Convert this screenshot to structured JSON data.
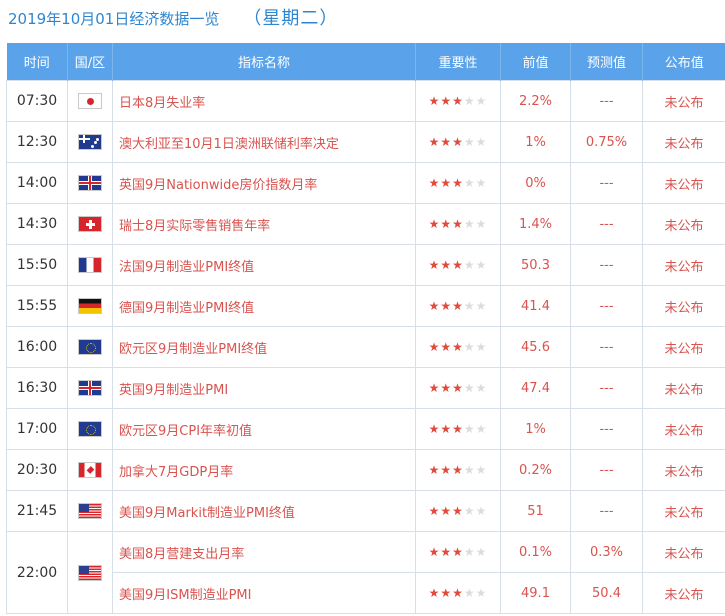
{
  "title": {
    "date_text": "2019年10月01日经济数据一览",
    "weekday": "（星期二）"
  },
  "headers": [
    "时间",
    "国/区",
    "指标名称",
    "重要性",
    "前值",
    "预测值",
    "公布值"
  ],
  "colors": {
    "accent": "#2f86d0",
    "header_bg": "#5aa3ea",
    "value_red": "#d9534f",
    "star_on": "#e14b3b",
    "star_off": "#dcdcdc"
  },
  "groups": [
    {
      "time": "07:30",
      "flag": "japan-flag-icon",
      "flag_class": "flag-jp",
      "items": [
        {
          "name": "日本8月失业率",
          "importance": 3,
          "previous": "2.2%",
          "forecast": "---",
          "actual": "未公布"
        }
      ]
    },
    {
      "time": "12:30",
      "flag": "australia-flag-icon",
      "flag_class": "flag-au",
      "items": [
        {
          "name": "澳大利亚至10月1日澳洲联储利率决定",
          "importance": 3,
          "previous": "1%",
          "forecast": "0.75%",
          "actual": "未公布"
        }
      ]
    },
    {
      "time": "14:00",
      "flag": "uk-flag-icon",
      "flag_class": "flag-uk",
      "items": [
        {
          "name": "英国9月Nationwide房价指数月率",
          "importance": 3,
          "previous": "0%",
          "forecast": "---",
          "actual": "未公布"
        }
      ]
    },
    {
      "time": "14:30",
      "flag": "switzerland-flag-icon",
      "flag_class": "flag-ch",
      "items": [
        {
          "name": "瑞士8月实际零售销售年率",
          "importance": 3,
          "previous": "1.4%",
          "forecast": "---",
          "actual": "未公布"
        }
      ]
    },
    {
      "time": "15:50",
      "flag": "france-flag-icon",
      "flag_class": "flag-fr",
      "items": [
        {
          "name": "法国9月制造业PMI终值",
          "importance": 3,
          "previous": "50.3",
          "forecast": "---",
          "actual": "未公布"
        }
      ]
    },
    {
      "time": "15:55",
      "flag": "germany-flag-icon",
      "flag_class": "flag-de",
      "items": [
        {
          "name": "德国9月制造业PMI终值",
          "importance": 3,
          "previous": "41.4",
          "forecast": "---",
          "actual": "未公布"
        }
      ]
    },
    {
      "time": "16:00",
      "flag": "eurozone-flag-icon",
      "flag_class": "flag-eu",
      "items": [
        {
          "name": "欧元区9月制造业PMI终值",
          "importance": 3,
          "previous": "45.6",
          "forecast": "---",
          "actual": "未公布"
        }
      ]
    },
    {
      "time": "16:30",
      "flag": "uk-flag-icon",
      "flag_class": "flag-uk",
      "items": [
        {
          "name": "英国9月制造业PMI",
          "importance": 3,
          "previous": "47.4",
          "forecast": "---",
          "actual": "未公布"
        }
      ]
    },
    {
      "time": "17:00",
      "flag": "eurozone-flag-icon",
      "flag_class": "flag-eu",
      "items": [
        {
          "name": "欧元区9月CPI年率初值",
          "importance": 3,
          "previous": "1%",
          "forecast": "---",
          "actual": "未公布"
        }
      ]
    },
    {
      "time": "20:30",
      "flag": "canada-flag-icon",
      "flag_class": "flag-ca",
      "items": [
        {
          "name": "加拿大7月GDP月率",
          "importance": 3,
          "previous": "0.2%",
          "forecast": "---",
          "actual": "未公布"
        }
      ]
    },
    {
      "time": "21:45",
      "flag": "usa-flag-icon",
      "flag_class": "flag-us",
      "items": [
        {
          "name": "美国9月Markit制造业PMI终值",
          "importance": 3,
          "previous": "51",
          "forecast": "---",
          "actual": "未公布"
        }
      ]
    },
    {
      "time": "22:00",
      "flag": "usa-flag-icon",
      "flag_class": "flag-us",
      "items": [
        {
          "name": "美国8月营建支出月率",
          "importance": 3,
          "previous": "0.1%",
          "forecast": "0.3%",
          "actual": "未公布"
        },
        {
          "name": "美国9月ISM制造业PMI",
          "importance": 3,
          "previous": "49.1",
          "forecast": "50.4",
          "actual": "未公布"
        }
      ]
    }
  ]
}
